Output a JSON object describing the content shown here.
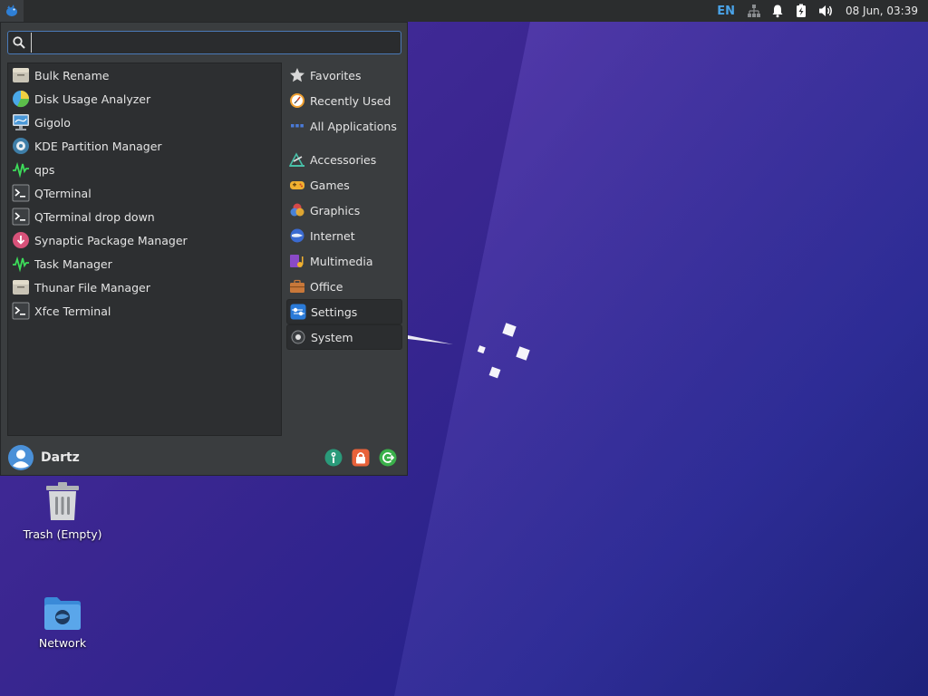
{
  "panel": {
    "keyboard_layout": "EN",
    "clock": "08 Jun, 03:39"
  },
  "menu": {
    "search": {
      "value": "",
      "placeholder": ""
    },
    "applications": [
      {
        "label": "Bulk Rename",
        "icon": "bulk-rename-icon"
      },
      {
        "label": "Disk Usage Analyzer",
        "icon": "disk-usage-icon"
      },
      {
        "label": "Gigolo",
        "icon": "gigolo-icon"
      },
      {
        "label": "KDE Partition Manager",
        "icon": "partition-manager-icon"
      },
      {
        "label": "qps",
        "icon": "qps-icon"
      },
      {
        "label": "QTerminal",
        "icon": "terminal-icon"
      },
      {
        "label": "QTerminal drop down",
        "icon": "terminal-icon"
      },
      {
        "label": "Synaptic Package Manager",
        "icon": "synaptic-icon"
      },
      {
        "label": "Task Manager",
        "icon": "task-manager-icon"
      },
      {
        "label": "Thunar File Manager",
        "icon": "file-manager-icon"
      },
      {
        "label": "Xfce Terminal",
        "icon": "terminal-icon"
      }
    ],
    "categories": [
      {
        "label": "Favorites",
        "icon": "star-icon"
      },
      {
        "label": "Recently Used",
        "icon": "clock-icon"
      },
      {
        "label": "All Applications",
        "icon": "grid-icon"
      },
      {
        "label": "Accessories",
        "icon": "accessories-icon"
      },
      {
        "label": "Games",
        "icon": "gamepad-icon"
      },
      {
        "label": "Graphics",
        "icon": "graphics-icon"
      },
      {
        "label": "Internet",
        "icon": "globe-icon"
      },
      {
        "label": "Multimedia",
        "icon": "multimedia-icon"
      },
      {
        "label": "Office",
        "icon": "briefcase-icon"
      },
      {
        "label": "Settings",
        "icon": "settings-icon"
      },
      {
        "label": "System",
        "icon": "system-gear-icon"
      }
    ],
    "user": {
      "name": "Dartz"
    }
  },
  "desktop": {
    "trash": {
      "label": "Trash (Empty)"
    },
    "network": {
      "label": "Network"
    }
  },
  "colors": {
    "accent": "#4a7ab8",
    "panel_bg": "#2b2d2e",
    "menu_bg": "#3a3d3f",
    "wallpaper": "#3a2690"
  }
}
